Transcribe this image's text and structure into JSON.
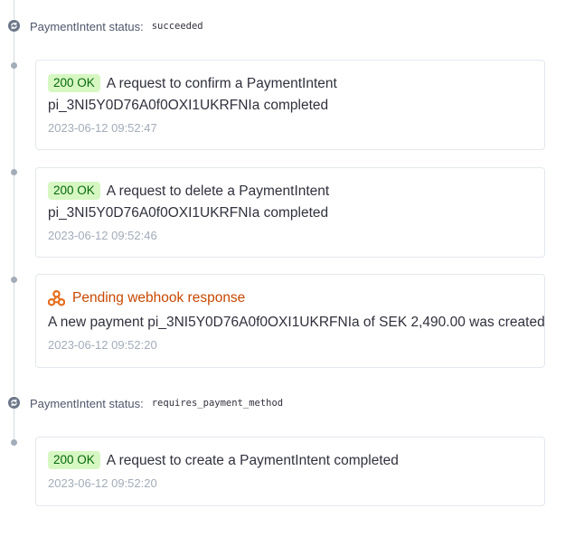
{
  "timeline": {
    "status_top": {
      "label": "PaymentIntent status:",
      "value": "succeeded"
    },
    "event_confirm": {
      "badge": "200 OK",
      "line1": "A request to confirm a PaymentIntent",
      "line2": "pi_3NI5Y0D76A0f0OXI1UKRFNIa completed",
      "timestamp": "2023-06-12 09:52:47"
    },
    "event_delete": {
      "badge": "200 OK",
      "line1": "A request to delete a PaymentIntent",
      "line2": "pi_3NI5Y0D76A0f0OXI1UKRFNIa completed",
      "timestamp": "2023-06-12 09:52:46"
    },
    "event_webhook": {
      "icon": "webhook-icon",
      "title": "Pending webhook response",
      "description": "A new payment pi_3NI5Y0D76A0f0OXI1UKRFNIa of SEK 2,490.00 was created",
      "timestamp": "2023-06-12 09:52:20"
    },
    "status_bottom": {
      "label": "PaymentIntent status:",
      "value": "requires_payment_method"
    },
    "event_create": {
      "badge": "200 OK",
      "line1": "A request to create a PaymentIntent completed",
      "timestamp": "2023-06-12 09:52:20"
    }
  },
  "colors": {
    "badge_bg": "#d7f7c2",
    "badge_text": "#05690d",
    "pending_text": "#c84801",
    "timestamp": "#a3acb9",
    "rail": "#d5dbe1"
  }
}
